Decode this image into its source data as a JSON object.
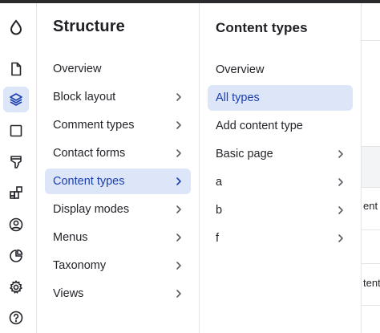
{
  "rail": {
    "items": [
      {
        "icon": "drop-logo-icon"
      },
      {
        "icon": "document-icon"
      },
      {
        "icon": "layers-icon",
        "active": true
      },
      {
        "icon": "square-icon"
      },
      {
        "icon": "paint-brush-icon"
      },
      {
        "icon": "extend-blocks-icon"
      },
      {
        "icon": "user-circle-icon"
      },
      {
        "icon": "pie-chart-icon"
      },
      {
        "icon": "gear-icon"
      },
      {
        "icon": "help-icon"
      }
    ]
  },
  "structure": {
    "title": "Structure",
    "items": [
      {
        "label": "Overview",
        "chevron": false
      },
      {
        "label": "Block layout",
        "chevron": true
      },
      {
        "label": "Comment types",
        "chevron": true
      },
      {
        "label": "Contact forms",
        "chevron": true
      },
      {
        "label": "Content types",
        "chevron": true,
        "active": true
      },
      {
        "label": "Display modes",
        "chevron": true
      },
      {
        "label": "Menus",
        "chevron": true
      },
      {
        "label": "Taxonomy",
        "chevron": true
      },
      {
        "label": "Views",
        "chevron": true
      }
    ]
  },
  "content_types": {
    "title": "Content types",
    "items": [
      {
        "label": "Overview",
        "chevron": false
      },
      {
        "label": "All types",
        "chevron": false,
        "active": true
      },
      {
        "label": "Add content type",
        "chevron": false
      },
      {
        "label": "Basic page",
        "chevron": true
      },
      {
        "label": "a",
        "chevron": true
      },
      {
        "label": "b",
        "chevron": true
      },
      {
        "label": "f",
        "chevron": true
      }
    ]
  },
  "background": {
    "text1": "ent",
    "text2": "tent"
  },
  "colors": {
    "accent": "#1b3fae",
    "active_bg": "#dde5f8",
    "border": "#e3e4e8"
  }
}
